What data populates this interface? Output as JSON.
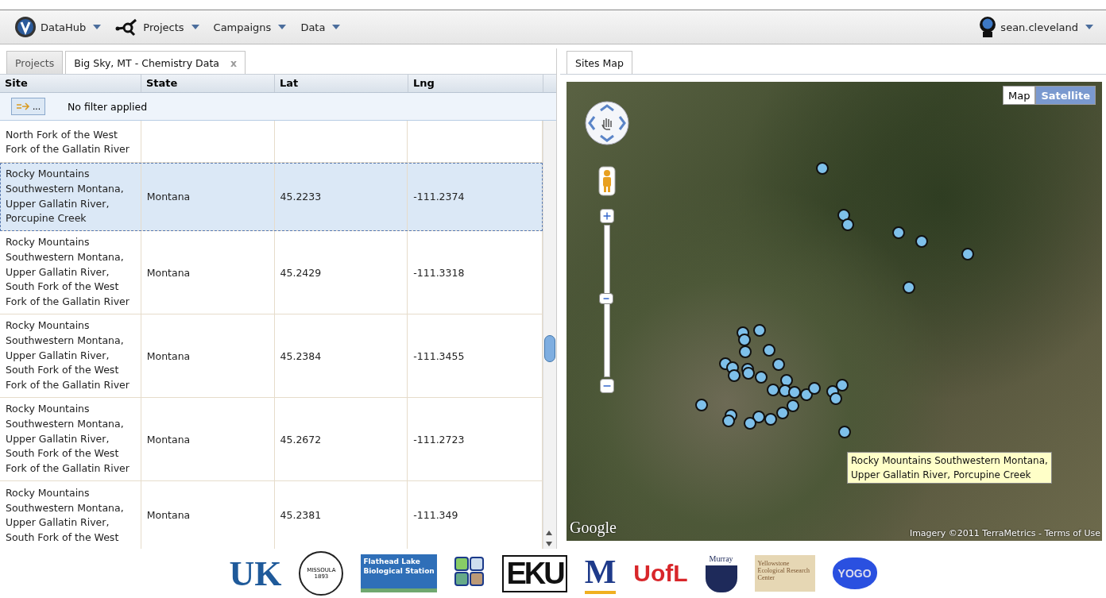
{
  "navbar": {
    "menus": [
      {
        "label": "DataHub",
        "kind": "brand"
      },
      {
        "label": "Projects",
        "kind": "network"
      },
      {
        "label": "Campaigns",
        "kind": "plain"
      },
      {
        "label": "Data",
        "kind": "plain"
      }
    ],
    "user": {
      "label": "sean.cleveland"
    }
  },
  "left_panel": {
    "tabs": [
      {
        "label": "Projects",
        "selected": false
      },
      {
        "label": "Big Sky, MT - Chemistry Data",
        "selected": true,
        "close": "x"
      }
    ],
    "table": {
      "columns": [
        "Site",
        "State",
        "Lat",
        "Lng"
      ],
      "filter": {
        "button": "...",
        "text": "No filter applied"
      },
      "rows": [
        {
          "site": [
            "North Fork of the West",
            "Fork of the Gallatin River"
          ],
          "state": "",
          "lat": "",
          "lng": "",
          "selected": false
        },
        {
          "site": [
            "Rocky Mountains",
            "Southwestern Montana,",
            "Upper Gallatin River,",
            "Porcupine Creek"
          ],
          "state": "Montana",
          "lat": "45.2233",
          "lng": "-111.2374",
          "selected": true
        },
        {
          "site": [
            "Rocky Mountains",
            "Southwestern Montana,",
            "Upper Gallatin River,",
            "South Fork of the West",
            "Fork of the Gallatin River"
          ],
          "state": "Montana",
          "lat": "45.2429",
          "lng": "-111.3318",
          "selected": false
        },
        {
          "site": [
            "Rocky Mountains",
            "Southwestern Montana,",
            "Upper Gallatin River,",
            "South Fork of the West",
            "Fork of the Gallatin River"
          ],
          "state": "Montana",
          "lat": "45.2384",
          "lng": "-111.3455",
          "selected": false
        },
        {
          "site": [
            "Rocky Mountains",
            "Southwestern Montana,",
            "Upper Gallatin River,",
            "South Fork of the West",
            "Fork of the Gallatin River"
          ],
          "state": "Montana",
          "lat": "45.2672",
          "lng": "-111.2723",
          "selected": false
        },
        {
          "site": [
            "Rocky Mountains",
            "Southwestern Montana,",
            "Upper Gallatin River,",
            "South Fork of the West"
          ],
          "state": "Montana",
          "lat": "45.2381",
          "lng": "-111.349",
          "selected": false
        }
      ]
    }
  },
  "right_panel": {
    "tabs": [
      {
        "label": "Sites Map",
        "selected": true
      }
    ],
    "map": {
      "types": [
        {
          "label": "Map",
          "selected": false
        },
        {
          "label": "Satellite",
          "selected": true
        }
      ],
      "zoom": {
        "level": 0.52
      },
      "tooltip": [
        "Rocky Mountains Southwestern Montana,",
        "Upper Gallatin River, Porcupine Creek"
      ],
      "logo": "Google",
      "attribution": "Imagery ©2011 TerraMetrics - Terms of Use"
    }
  },
  "footer": {
    "logos": [
      {
        "kind": "uk",
        "text": "UK"
      },
      {
        "kind": "seal",
        "text": "MISSOULA 1893"
      },
      {
        "kind": "lake",
        "text": "Flathead Lake Biological Station"
      },
      {
        "kind": "grid"
      },
      {
        "kind": "eku",
        "text": "EKU"
      },
      {
        "kind": "m",
        "text": "M"
      },
      {
        "kind": "uofl",
        "text": "UofL"
      },
      {
        "kind": "murray",
        "text": "Murray"
      },
      {
        "kind": "yerc",
        "text": "Yellowstone Ecological Research Center"
      },
      {
        "kind": "yogo",
        "text": "YOGO"
      }
    ]
  }
}
